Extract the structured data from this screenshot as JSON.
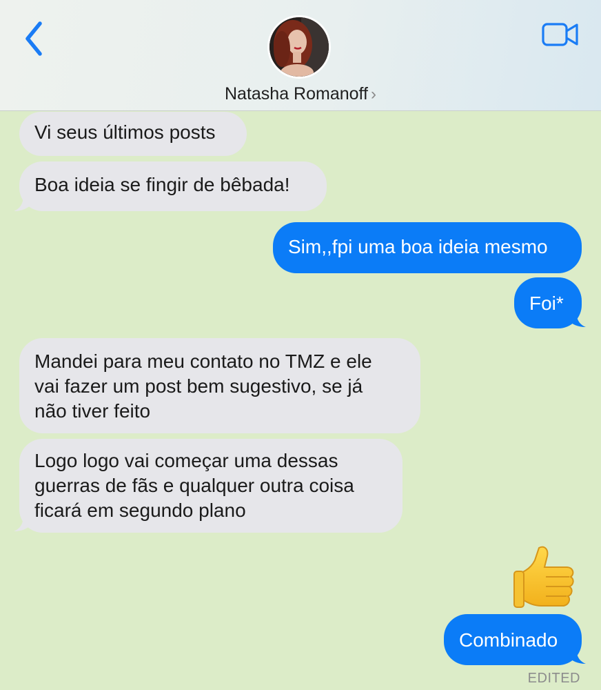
{
  "header": {
    "back_icon": "chevron-left-icon",
    "video_icon": "video-camera-icon",
    "contact_name": "Natasha Romanoff",
    "chevron": "›",
    "accent": "#1a7cf5"
  },
  "messages": [
    {
      "direction": "incoming",
      "text": "Vi seus últimos posts"
    },
    {
      "direction": "incoming",
      "text": "Boa ideia se fingir de bêbada!"
    },
    {
      "direction": "outgoing",
      "text": "Sim,,fpi uma boa ideia mesmo"
    },
    {
      "direction": "outgoing",
      "text": "Foi*"
    },
    {
      "direction": "incoming",
      "lines": [
        "Mandei para meu contato no TMZ e ele",
        "vai fazer um post bem sugestivo, se já",
        "não tiver feito"
      ]
    },
    {
      "direction": "incoming",
      "lines": [
        "Logo logo vai começar uma dessas",
        "guerras de fãs e qualquer outra coisa",
        "ficará em segundo plano"
      ]
    },
    {
      "direction": "outgoing",
      "emoji": "thumbs-up-emoji"
    },
    {
      "direction": "outgoing",
      "text": "Combinado"
    }
  ],
  "status": {
    "edited_label": "EDITED"
  },
  "colors": {
    "background": "#dcecc8",
    "incoming_bubble": "#e6e6ea",
    "outgoing_bubble": "#0b7cf7"
  }
}
